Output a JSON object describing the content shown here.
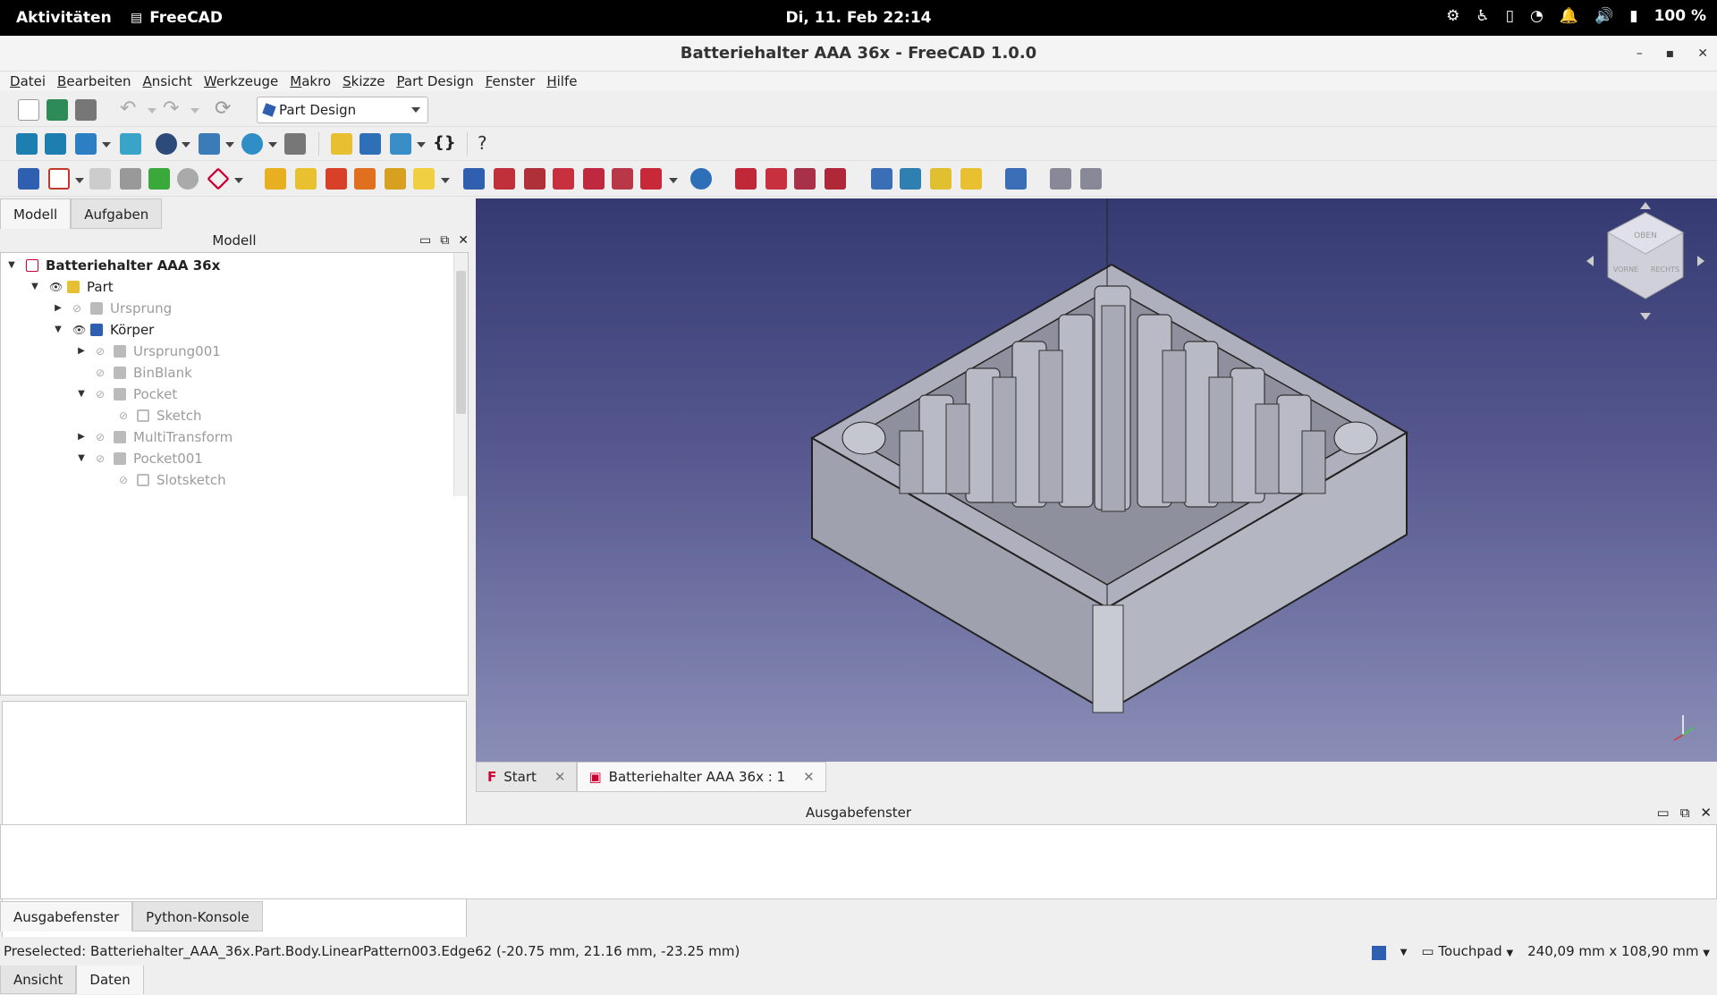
{
  "topbar": {
    "activities": "Aktivitäten",
    "app_name": "FreeCAD",
    "clock": "Di, 11. Feb  22:14",
    "battery": "100 %",
    "tray_icons": [
      "settings-icon",
      "accessibility-icon",
      "screen-rotate-icon",
      "wifi-icon",
      "notification-bell-icon",
      "volume-icon",
      "battery-icon"
    ]
  },
  "window": {
    "title": "Batteriehalter AAA 36x - FreeCAD 1.0.0",
    "minimize": "–",
    "maximize": "▪",
    "close": "✕"
  },
  "menu": [
    "Datei",
    "Bearbeiten",
    "Ansicht",
    "Werkzeuge",
    "Makro",
    "Skizze",
    "Part Design",
    "Fenster",
    "Hilfe"
  ],
  "workbench": {
    "selected": "Part Design"
  },
  "left_panel": {
    "tabs": [
      "Modell",
      "Aufgaben"
    ],
    "header": "Modell",
    "tree": [
      {
        "label": "Batteriehalter AAA 36x",
        "level": 0,
        "expanded": true,
        "bold": true,
        "dim": false
      },
      {
        "label": "Part",
        "level": 1,
        "expanded": true,
        "dim": false
      },
      {
        "label": "Ursprung",
        "level": 2,
        "expanded": false,
        "dim": true
      },
      {
        "label": "Körper",
        "level": 2,
        "expanded": true,
        "dim": false
      },
      {
        "label": "Ursprung001",
        "level": 3,
        "expanded": false,
        "dim": true
      },
      {
        "label": "BinBlank",
        "level": 3,
        "dim": true
      },
      {
        "label": "Pocket",
        "level": 3,
        "expanded": true,
        "dim": true
      },
      {
        "label": "Sketch",
        "level": 4,
        "dim": true
      },
      {
        "label": "MultiTransform",
        "level": 3,
        "expanded": false,
        "dim": true
      },
      {
        "label": "Pocket001",
        "level": 3,
        "expanded": true,
        "dim": true
      },
      {
        "label": "Slotsketch",
        "level": 4,
        "dim": true
      }
    ],
    "bottom_tabs": [
      "Ansicht",
      "Daten"
    ]
  },
  "doc_tabs": [
    {
      "label": "Start",
      "active": false
    },
    {
      "label": "Batteriehalter AAA 36x : 1",
      "active": true
    }
  ],
  "output": {
    "header": "Ausgabefenster",
    "tabs": [
      "Ausgabefenster",
      "Python-Konsole"
    ]
  },
  "status": {
    "message": "Preselected: Batteriehalter_AAA_36x.Part.Body.LinearPattern003.Edge62 (-20.75 mm, 21.16 mm, -23.25 mm)",
    "nav_style": "Touchpad",
    "dimensions": "240,09 mm x 108,90 mm"
  },
  "navcube": {
    "faces": [
      "OBEN",
      "VORNE",
      "RECHTS"
    ]
  },
  "colors": {
    "viewport_top": "#353a72",
    "viewport_bottom": "#8a8eb6",
    "model": "#a7a9b6"
  }
}
